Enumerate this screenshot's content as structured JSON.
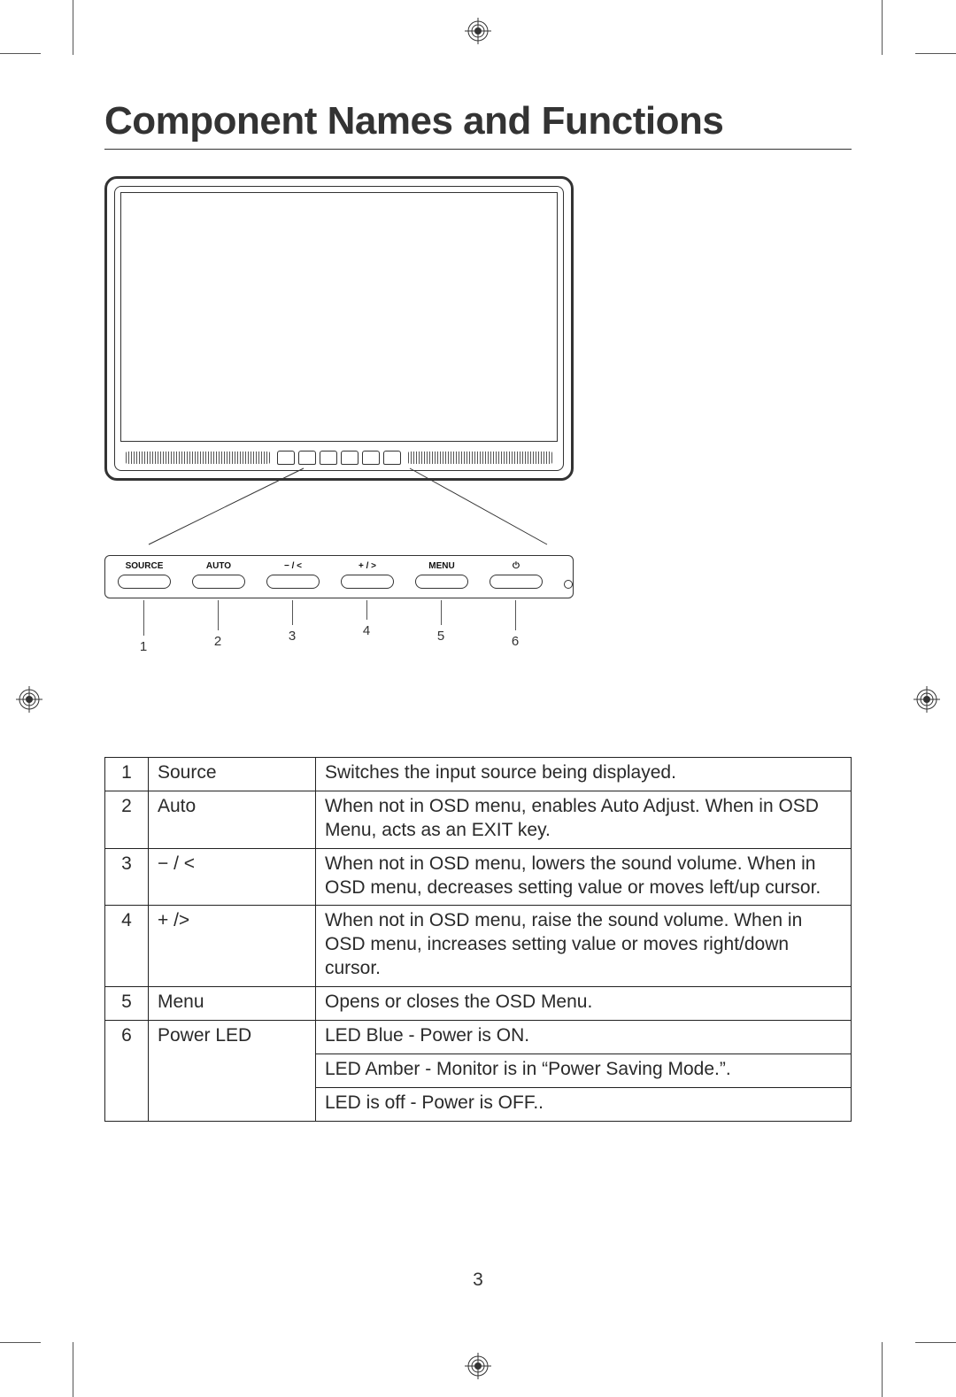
{
  "title": "Component Names and Functions",
  "panel": {
    "buttons": [
      {
        "label": "SOURCE",
        "num": "1"
      },
      {
        "label": "AUTO",
        "num": "2"
      },
      {
        "label": "− / <",
        "num": "3"
      },
      {
        "label": "+ / >",
        "num": "4"
      },
      {
        "label": "MENU",
        "num": "5"
      },
      {
        "label": "⏻",
        "num": "6"
      }
    ],
    "led_num": "6"
  },
  "table": [
    {
      "num": "1",
      "name": "Source",
      "desc": "Switches the input source being displayed."
    },
    {
      "num": "2",
      "name": "Auto",
      "desc": "When not in OSD menu, enables Auto Adjust. When in OSD Menu, acts as an EXIT key."
    },
    {
      "num": "3",
      "name": "− / <",
      "desc": "When not in OSD menu, lowers the sound volume. When in OSD menu, decreases setting value or moves left/up cursor."
    },
    {
      "num": "4",
      "name": "+ /",
      "name_suffix": ">",
      "desc": "When not in OSD menu, raise the sound volume. When in OSD menu, increases setting value or moves right/down cursor."
    },
    {
      "num": "5",
      "name": "Menu",
      "desc": "Opens or closes the OSD Menu."
    },
    {
      "num": "6",
      "name": "Power LED",
      "desc_lines": [
        "LED Blue - Power is ON.",
        "LED Amber - Monitor is in “Power Saving Mode.”.",
        "LED is off - Power is OFF.."
      ]
    }
  ],
  "page_number": "3"
}
